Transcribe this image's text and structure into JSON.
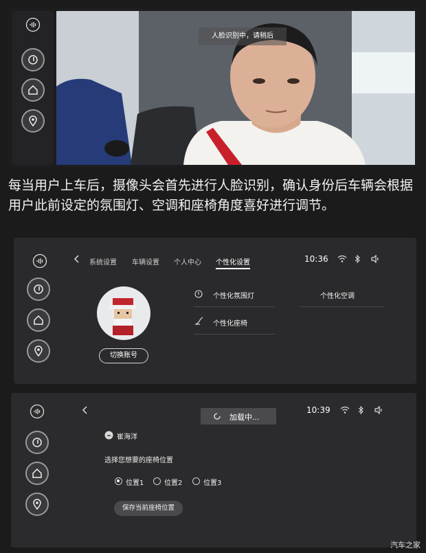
{
  "panel1": {
    "hint_text": "人脸识别中，请稍后"
  },
  "caption": "每当用户上车后，摄像头会首先进行人脸识别，确认身份后车辆会根据用户此前设定的氛围灯、空调和座椅角度喜好进行调节。",
  "panel2": {
    "tabs": [
      "系统设置",
      "车辆设置",
      "个人中心",
      "个性化设置"
    ],
    "active_tab": "个性化设置",
    "time": "10:36",
    "items": {
      "ambient_light": "个性化氛围灯",
      "air_conditioning": "个性化空调",
      "seat": "个性化座椅"
    },
    "switch_account": "切换账号"
  },
  "panel3": {
    "loading_text": "加载中...",
    "time": "10:39",
    "username": "崔海洋",
    "prompt": "选择您想要的座椅位置",
    "positions": [
      "位置1",
      "位置2",
      "位置3"
    ],
    "selected_position": "位置1",
    "save_button": "保存当前座椅位置"
  },
  "watermark": "汽车之家",
  "colors": {
    "background": "#1b1b1b",
    "panel": "#2a2a2c",
    "active_underline": "#ffffff"
  }
}
